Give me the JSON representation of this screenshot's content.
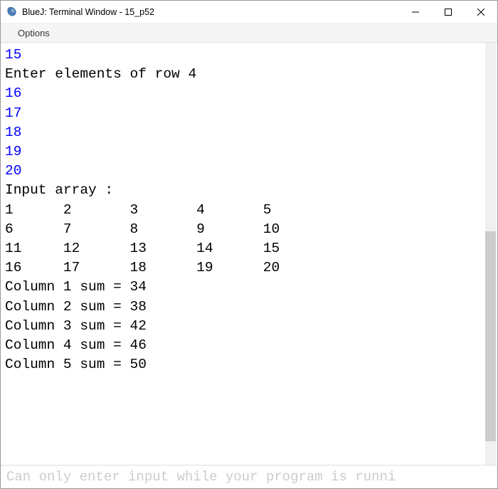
{
  "window": {
    "title": "BlueJ: Terminal Window - 15_p52"
  },
  "menu": {
    "options": "Options"
  },
  "terminal": {
    "lines": [
      {
        "text": "15",
        "type": "input"
      },
      {
        "text": "Enter elements of row 4",
        "type": "output"
      },
      {
        "text": "16",
        "type": "input"
      },
      {
        "text": "17",
        "type": "input"
      },
      {
        "text": "18",
        "type": "input"
      },
      {
        "text": "19",
        "type": "input"
      },
      {
        "text": "20",
        "type": "input"
      },
      {
        "text": "Input array :",
        "type": "output"
      },
      {
        "text": "1      2       3       4       5",
        "type": "output"
      },
      {
        "text": "6      7       8       9       10",
        "type": "output"
      },
      {
        "text": "11     12      13      14      15",
        "type": "output"
      },
      {
        "text": "16     17      18      19      20",
        "type": "output"
      },
      {
        "text": "Column 1 sum = 34",
        "type": "output"
      },
      {
        "text": "Column 2 sum = 38",
        "type": "output"
      },
      {
        "text": "Column 3 sum = 42",
        "type": "output"
      },
      {
        "text": "Column 4 sum = 46",
        "type": "output"
      },
      {
        "text": "Column 5 sum = 50",
        "type": "output"
      }
    ]
  },
  "input_bar": {
    "placeholder": "Can only enter input while your program is runni"
  }
}
